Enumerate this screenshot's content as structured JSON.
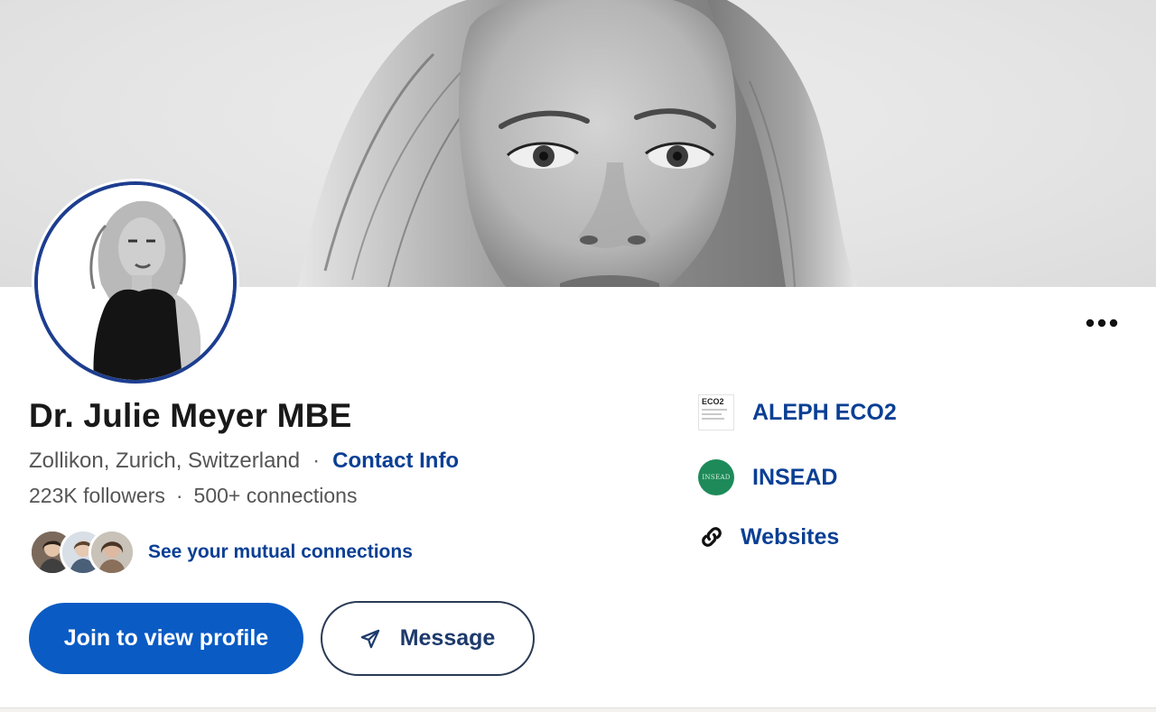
{
  "profile": {
    "name": "Dr. Julie Meyer MBE",
    "location": "Zollikon, Zurich, Switzerland",
    "separator": "·",
    "contact_info_label": "Contact Info",
    "followers": "223K followers",
    "connections": "500+ connections",
    "mutual_connections_label": "See your mutual connections"
  },
  "actions": {
    "join_label": "Join to view profile",
    "message_label": "Message",
    "more_icon": "more-horizontal-icon"
  },
  "side_links": [
    {
      "label": "ALEPH ECO2",
      "logo_text": "ECO2"
    },
    {
      "label": "INSEAD",
      "logo_text": "INSEAD"
    },
    {
      "label": "Websites",
      "icon": "link-icon"
    }
  ],
  "colors": {
    "accent_blue": "#0a5bc4",
    "link_blue": "#0a3f94",
    "avatar_ring": "#1d3d8f",
    "insead_green": "#1e8a5a"
  }
}
